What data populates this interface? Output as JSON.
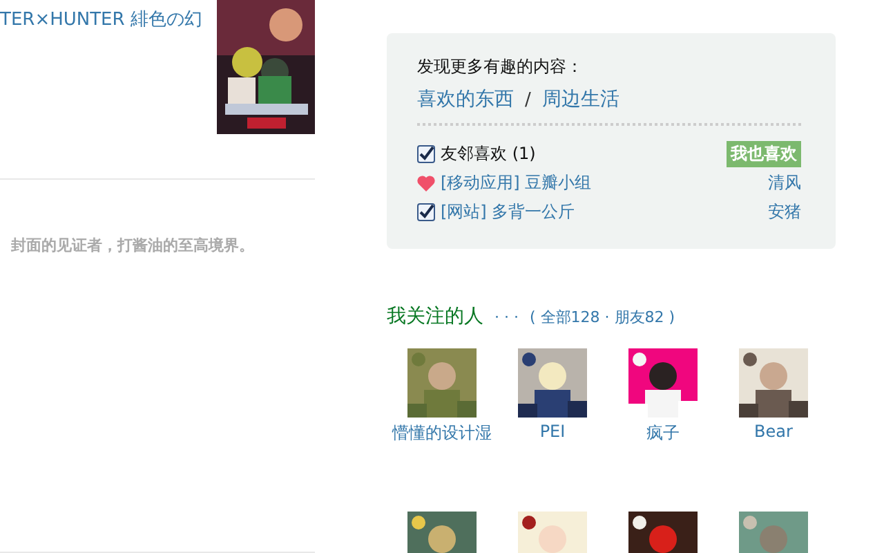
{
  "left": {
    "title": "TER×HUNTER 緋色の幻",
    "poster": {
      "kind": "picture"
    },
    "quote": "封面的见证者，打酱油的至高境界。"
  },
  "discover": {
    "heading": "发现更多有趣的内容：",
    "links": [
      "喜欢的东西",
      "周边生活"
    ],
    "separator": "/",
    "items": [
      {
        "kind": "checkbox",
        "checked": true,
        "label": "友邻喜欢 (1)",
        "button": "我也喜欢"
      },
      {
        "kind": "heart",
        "label": "[移动应用] 豆瓣小组",
        "user": "清风"
      },
      {
        "kind": "checkbox",
        "checked": true,
        "label": "[网站] 多背一公斤",
        "user": "安猪"
      }
    ]
  },
  "following": {
    "title": "我关注的人",
    "more": "· · ·",
    "counts": "( 全部128 · 朋友82 )",
    "people": [
      {
        "kind": "person",
        "name": "懵懂的设计湿"
      },
      {
        "kind": "person",
        "name": "PEI"
      },
      {
        "kind": "person",
        "name": "疯子"
      },
      {
        "kind": "person",
        "name": "Bear"
      },
      {
        "kind": "picture"
      },
      {
        "kind": "picture"
      },
      {
        "kind": "picture"
      },
      {
        "kind": "picture"
      }
    ]
  }
}
